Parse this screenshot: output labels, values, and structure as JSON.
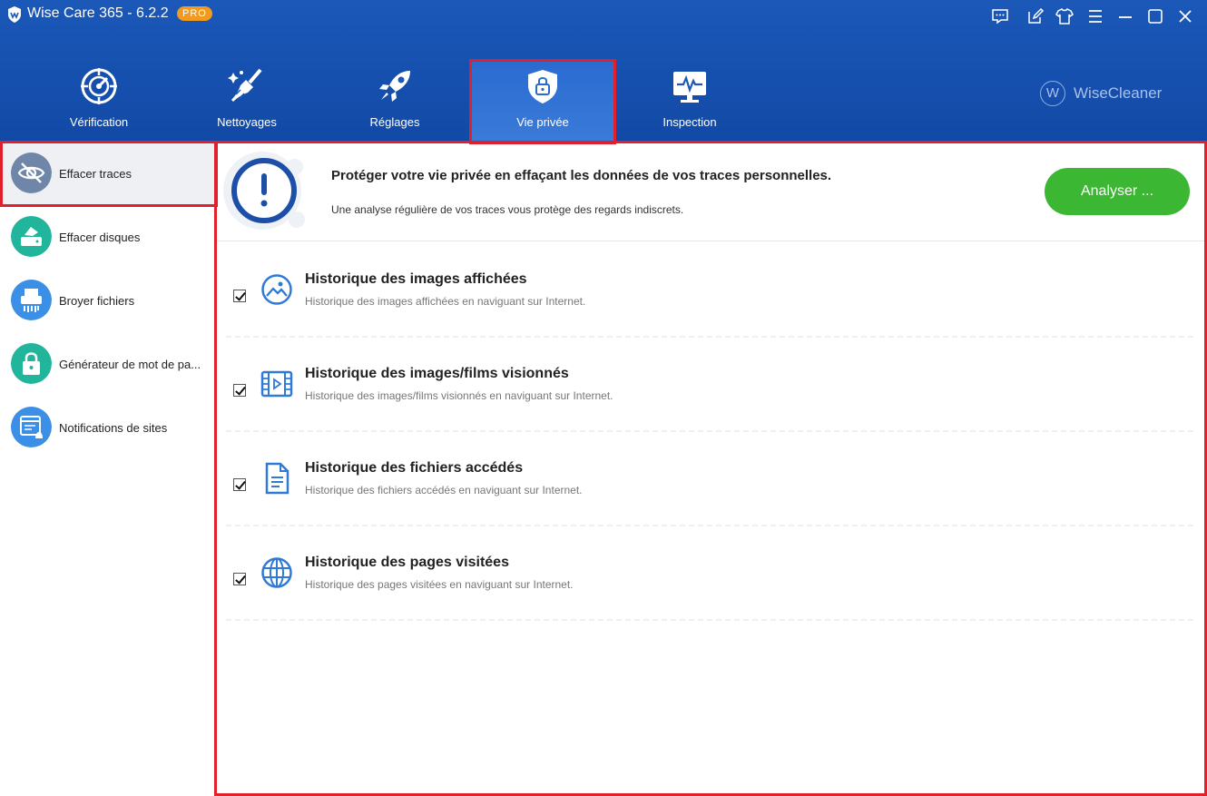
{
  "app": {
    "title": "Wise Care 365 - 6.2.2",
    "badge": "PRO"
  },
  "nav": {
    "tabs": [
      {
        "label": "Vérification",
        "icon": "radar-icon"
      },
      {
        "label": "Nettoyages",
        "icon": "broom-icon"
      },
      {
        "label": "Réglages",
        "icon": "rocket-icon"
      },
      {
        "label": "Vie privée",
        "icon": "shield-lock-icon",
        "active": true
      },
      {
        "label": "Inspection",
        "icon": "monitor-pulse-icon"
      }
    ],
    "brand": {
      "letter": "W",
      "name": "WiseCleaner"
    }
  },
  "sidebar": {
    "items": [
      {
        "label": "Effacer traces",
        "icon": "eye-slash-icon",
        "active": true
      },
      {
        "label": "Effacer disques",
        "icon": "disk-erase-icon"
      },
      {
        "label": "Broyer fichiers",
        "icon": "shredder-icon"
      },
      {
        "label": "Générateur de mot de pa...",
        "icon": "password-lock-icon"
      },
      {
        "label": "Notifications de sites",
        "icon": "site-notification-icon"
      }
    ]
  },
  "banner": {
    "title": "Protéger votre vie privée en effaçant les données de vos traces personnelles.",
    "subtitle": "Une analyse régulière de vos traces vous protège des regards indiscrets.",
    "button": "Analyser ..."
  },
  "items": [
    {
      "title": "Historique des images affichées",
      "desc": "Historique des images affichées en naviguant sur Internet.",
      "checked": true,
      "icon": "image-history-icon"
    },
    {
      "title": "Historique des images/films visionnés",
      "desc": "Historique des images/films visionnés en naviguant sur Internet.",
      "checked": true,
      "icon": "film-icon"
    },
    {
      "title": "Historique des fichiers accédés",
      "desc": "Historique des fichiers accédés en naviguant sur Internet.",
      "checked": true,
      "icon": "document-icon"
    },
    {
      "title": "Historique des pages visitées",
      "desc": "Historique des pages visitées en naviguant sur Internet.",
      "checked": true,
      "icon": "globe-icon"
    }
  ],
  "colors": {
    "header": "#1b58b8",
    "accent_green": "#3cb734",
    "highlight_red": "#e0202a",
    "icon_blue": "#2f7ad6"
  }
}
